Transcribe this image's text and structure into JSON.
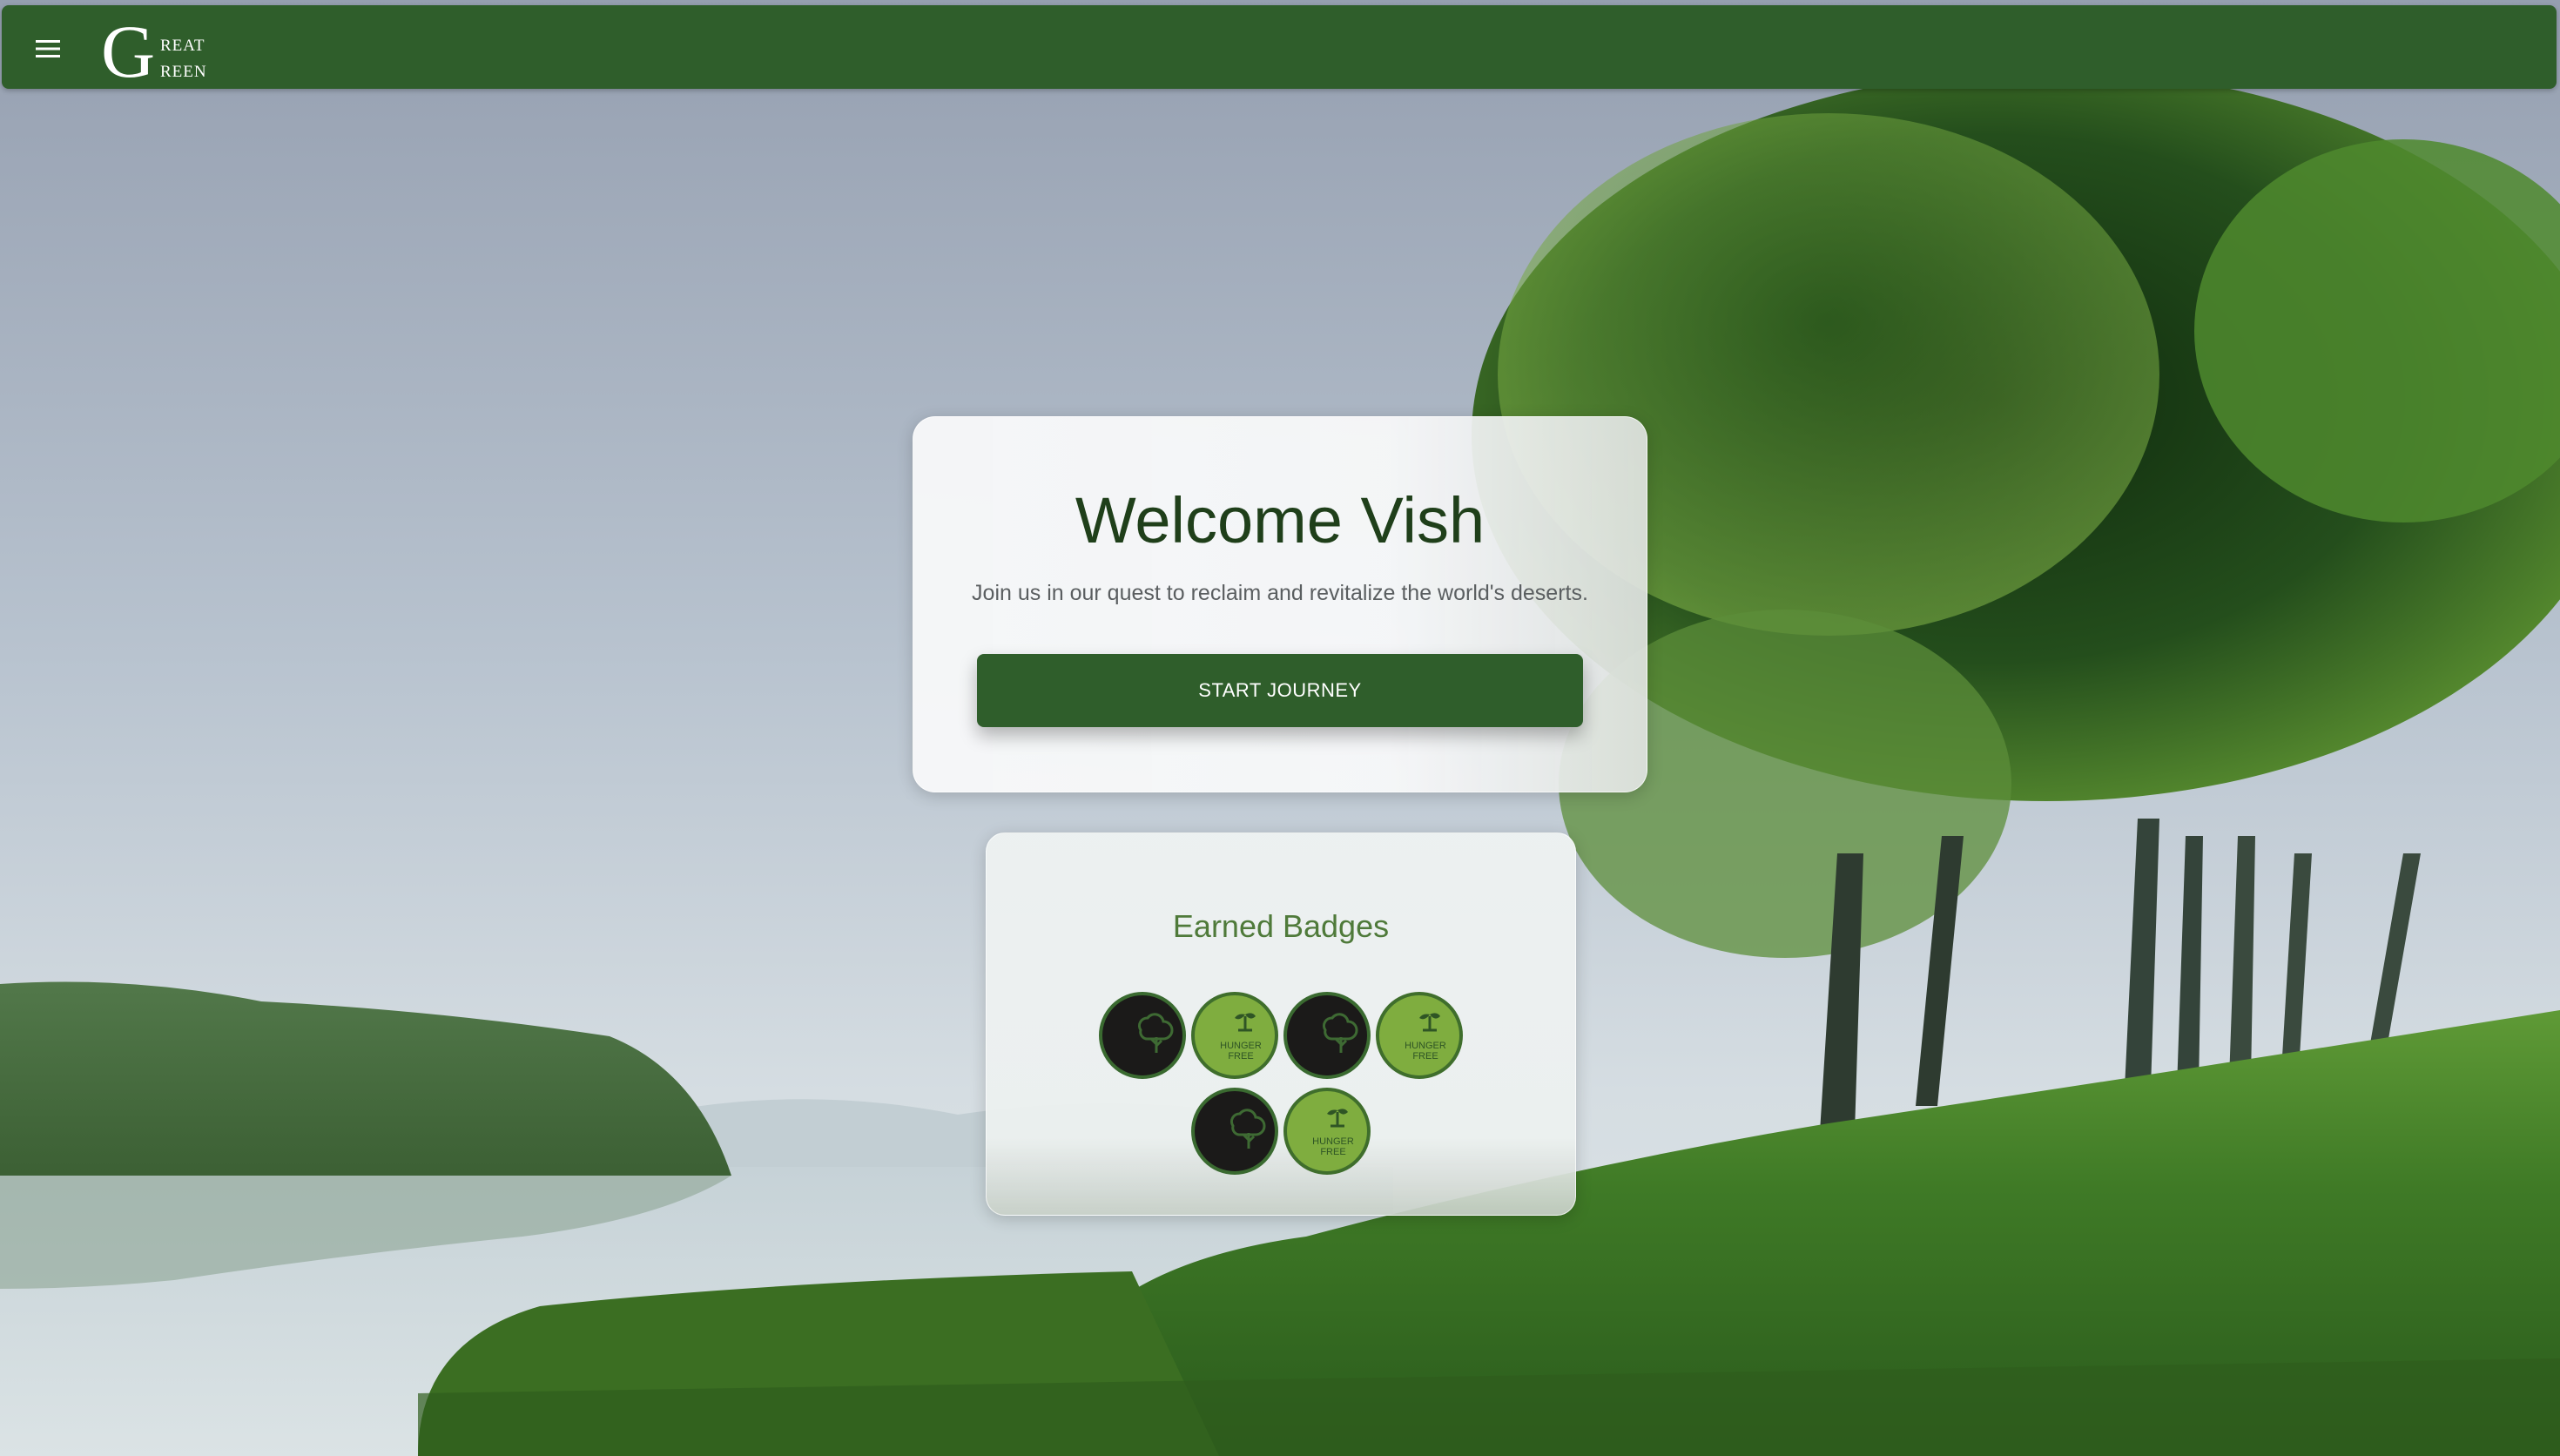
{
  "appbar": {
    "menu_icon": "hamburger-menu-icon",
    "logo": {
      "initial": "G",
      "line1": "REAT",
      "line2": "REEN"
    },
    "color": "#2f5e2b"
  },
  "welcome": {
    "title": "Welcome Vish",
    "subtitle": "Join us in our quest to reclaim and revitalize the world's deserts.",
    "button_label": "START JOURNEY"
  },
  "badges": {
    "title": "Earned Badges",
    "rows": [
      [
        {
          "type": "tree",
          "style": "dark",
          "icon": "tree-icon"
        },
        {
          "type": "hunger-free",
          "style": "light",
          "icon": "sprout-icon",
          "text_line1": "HUNGER",
          "text_line2": "FREE"
        },
        {
          "type": "tree",
          "style": "dark",
          "icon": "tree-icon"
        },
        {
          "type": "hunger-free",
          "style": "light",
          "icon": "sprout-icon",
          "text_line1": "HUNGER",
          "text_line2": "FREE"
        }
      ],
      [
        {
          "type": "tree",
          "style": "dark",
          "icon": "tree-icon"
        },
        {
          "type": "hunger-free",
          "style": "light",
          "icon": "sprout-icon",
          "text_line1": "HUNGER",
          "text_line2": "FREE"
        }
      ]
    ]
  },
  "colors": {
    "brand_green": "#2f5e2b",
    "title_dark_green": "#1f3f1a",
    "badge_light": "#7fad3f",
    "badge_dark": "#1b1a19"
  }
}
